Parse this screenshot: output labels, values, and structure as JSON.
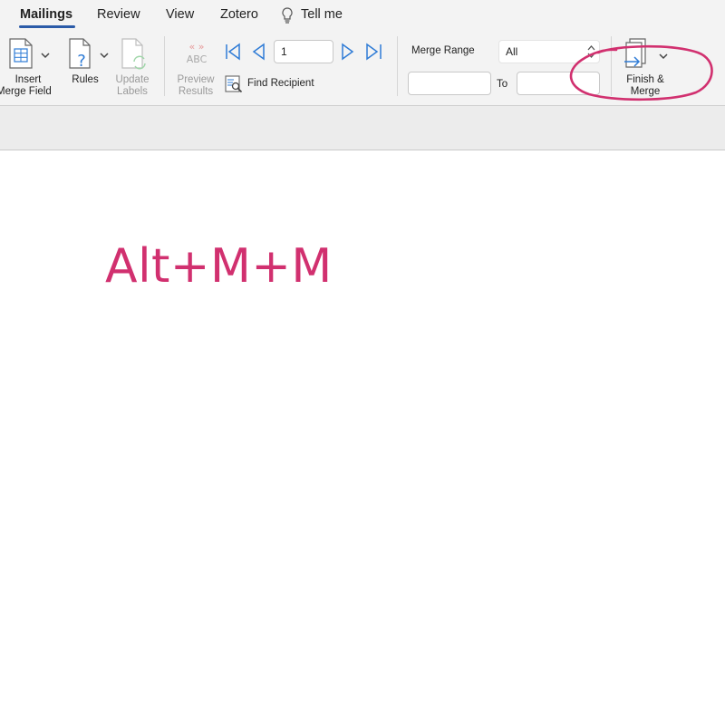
{
  "tabs": [
    {
      "label": "Mailings",
      "active": true
    },
    {
      "label": "Review"
    },
    {
      "label": "View"
    },
    {
      "label": "Zotero"
    },
    {
      "label": "Tell me",
      "icon": "lightbulb-icon"
    }
  ],
  "ribbon": {
    "insert_merge_field": {
      "line1": "Insert",
      "line2": "Merge Field"
    },
    "rules": "Rules",
    "update_labels": {
      "line1": "Update",
      "line2": "Labels"
    },
    "preview_results": {
      "line1": "Preview",
      "line2": "Results",
      "icon_text": "ABC"
    },
    "find_recipient": "Find Recipient",
    "record_number": "1",
    "merge_range_label": "Merge Range",
    "merge_range_value": "All",
    "to_label": "To",
    "from_value": "",
    "to_value": "",
    "finish_merge": {
      "line1": "Finish &",
      "line2": "Merge"
    }
  },
  "annotation": {
    "text": "Alt+M+M",
    "color": "#d1306f"
  },
  "colors": {
    "accent": "#2b5ba8",
    "icon_blue": "#2e7bd6",
    "highlight": "#d1306f"
  }
}
